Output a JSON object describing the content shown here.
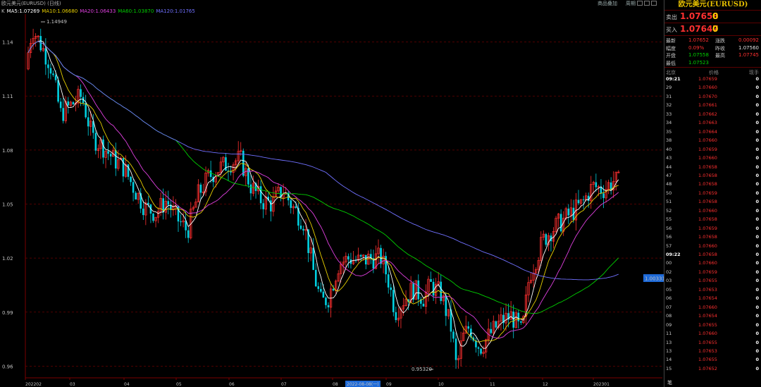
{
  "header": {
    "symbol_label": "欧元美元(EURUSD)",
    "period_label": "日线",
    "indicators": [
      {
        "name": "K",
        "value": "",
        "color": "#c0c0c0"
      },
      {
        "name": "MA5",
        "value": "1.07269",
        "color": "#ffffff"
      },
      {
        "name": "MA10",
        "value": "1.06680",
        "color": "#e8d000"
      },
      {
        "name": "MA20",
        "value": "1.06433",
        "color": "#e040e0"
      },
      {
        "name": "MA60",
        "value": "1.03870",
        "color": "#00d000"
      },
      {
        "name": "MA120",
        "value": "1.01765",
        "color": "#7070ff"
      }
    ],
    "right_links": [
      "商品叠加",
      "周期"
    ]
  },
  "chart_data": {
    "type": "candlestick",
    "y_ticks": [
      "1.14",
      "1.11",
      "1.08",
      "1.05",
      "1.02",
      "0.99",
      "0.96"
    ],
    "y_tick_values": [
      1.14,
      1.11,
      1.08,
      1.05,
      1.02,
      0.99,
      0.96
    ],
    "ylim": [
      0.9535,
      1.1555
    ],
    "x_ticks": [
      "202202",
      "03",
      "04",
      "05",
      "06",
      "07",
      "08",
      "09",
      "10",
      "11",
      "12",
      "202301"
    ],
    "high_label": "1.14949",
    "low_label": "0.95320",
    "current_marker": "1.00331",
    "selected_date": "2022-08-08(一)",
    "ma_colors": {
      "MA5": "#ffffff",
      "MA10": "#e8d000",
      "MA20": "#e040e0",
      "MA60": "#00d000",
      "MA120": "#7070ff"
    },
    "up_color": "#ff3030",
    "down_color": "#00d0e0",
    "grid": true
  },
  "panel": {
    "title": "欧元美元(EURUSD)",
    "sell_label": "卖出",
    "sell_price": "1.07658",
    "sell_vol": "0",
    "buy_label": "买入",
    "buy_price": "1.07647",
    "buy_vol": "0",
    "stats": [
      {
        "l1": "最新",
        "v1": "1.07652",
        "c1": "red",
        "l2": "涨跌",
        "v2": "0.00092",
        "c2": "red"
      },
      {
        "l1": "幅度",
        "v1": "0.09%",
        "c1": "red",
        "l2": "昨收",
        "v2": "1.07560",
        "c2": "white"
      },
      {
        "l1": "开盘",
        "v1": "1.07558",
        "c1": "green",
        "l2": "最高",
        "v2": "1.07745",
        "c2": "red"
      },
      {
        "l1": "最低",
        "v1": "1.07523",
        "c1": "green",
        "l2": "",
        "v2": "",
        "c2": "white"
      }
    ],
    "ticks_head": {
      "time": "北京",
      "price": "价格",
      "vol": "现手"
    },
    "ticks": [
      {
        "t": "09:21",
        "p": "1.07659",
        "v": "0",
        "bold": true
      },
      {
        "t": "29",
        "p": "1.07660",
        "v": "0"
      },
      {
        "t": "31",
        "p": "1.07670",
        "v": "0"
      },
      {
        "t": "32",
        "p": "1.07661",
        "v": "0"
      },
      {
        "t": "33",
        "p": "1.07662",
        "v": "0"
      },
      {
        "t": "34",
        "p": "1.07663",
        "v": "0"
      },
      {
        "t": "35",
        "p": "1.07664",
        "v": "0"
      },
      {
        "t": "38",
        "p": "1.07660",
        "v": "0"
      },
      {
        "t": "40",
        "p": "1.07659",
        "v": "0"
      },
      {
        "t": "43",
        "p": "1.07660",
        "v": "0"
      },
      {
        "t": "44",
        "p": "1.07658",
        "v": "0"
      },
      {
        "t": "47",
        "p": "1.07658",
        "v": "0"
      },
      {
        "t": "48",
        "p": "1.07658",
        "v": "0"
      },
      {
        "t": "50",
        "p": "1.07659",
        "v": "0"
      },
      {
        "t": "51",
        "p": "1.07658",
        "v": "0"
      },
      {
        "t": "52",
        "p": "1.07660",
        "v": "0"
      },
      {
        "t": "55",
        "p": "1.07658",
        "v": "0"
      },
      {
        "t": "56",
        "p": "1.07659",
        "v": "0"
      },
      {
        "t": "56",
        "p": "1.07658",
        "v": "0"
      },
      {
        "t": "57",
        "p": "1.07660",
        "v": "0"
      },
      {
        "t": "09:22",
        "p": "1.07658",
        "v": "0",
        "bold": true
      },
      {
        "t": "00",
        "p": "1.07660",
        "v": "0"
      },
      {
        "t": "02",
        "p": "1.07659",
        "v": "0"
      },
      {
        "t": "03",
        "p": "1.07655",
        "v": "0"
      },
      {
        "t": "05",
        "p": "1.07653",
        "v": "0"
      },
      {
        "t": "06",
        "p": "1.07654",
        "v": "0"
      },
      {
        "t": "07",
        "p": "1.07660",
        "v": "0"
      },
      {
        "t": "08",
        "p": "1.07654",
        "v": "0"
      },
      {
        "t": "09",
        "p": "1.07655",
        "v": "0"
      },
      {
        "t": "11",
        "p": "1.07660",
        "v": "0"
      },
      {
        "t": "13",
        "p": "1.07655",
        "v": "0"
      },
      {
        "t": "13",
        "p": "1.07653",
        "v": "0"
      },
      {
        "t": "14",
        "p": "1.07655",
        "v": "0"
      },
      {
        "t": "15",
        "p": "1.07652",
        "v": "0"
      }
    ],
    "bottom_label": "笔"
  }
}
